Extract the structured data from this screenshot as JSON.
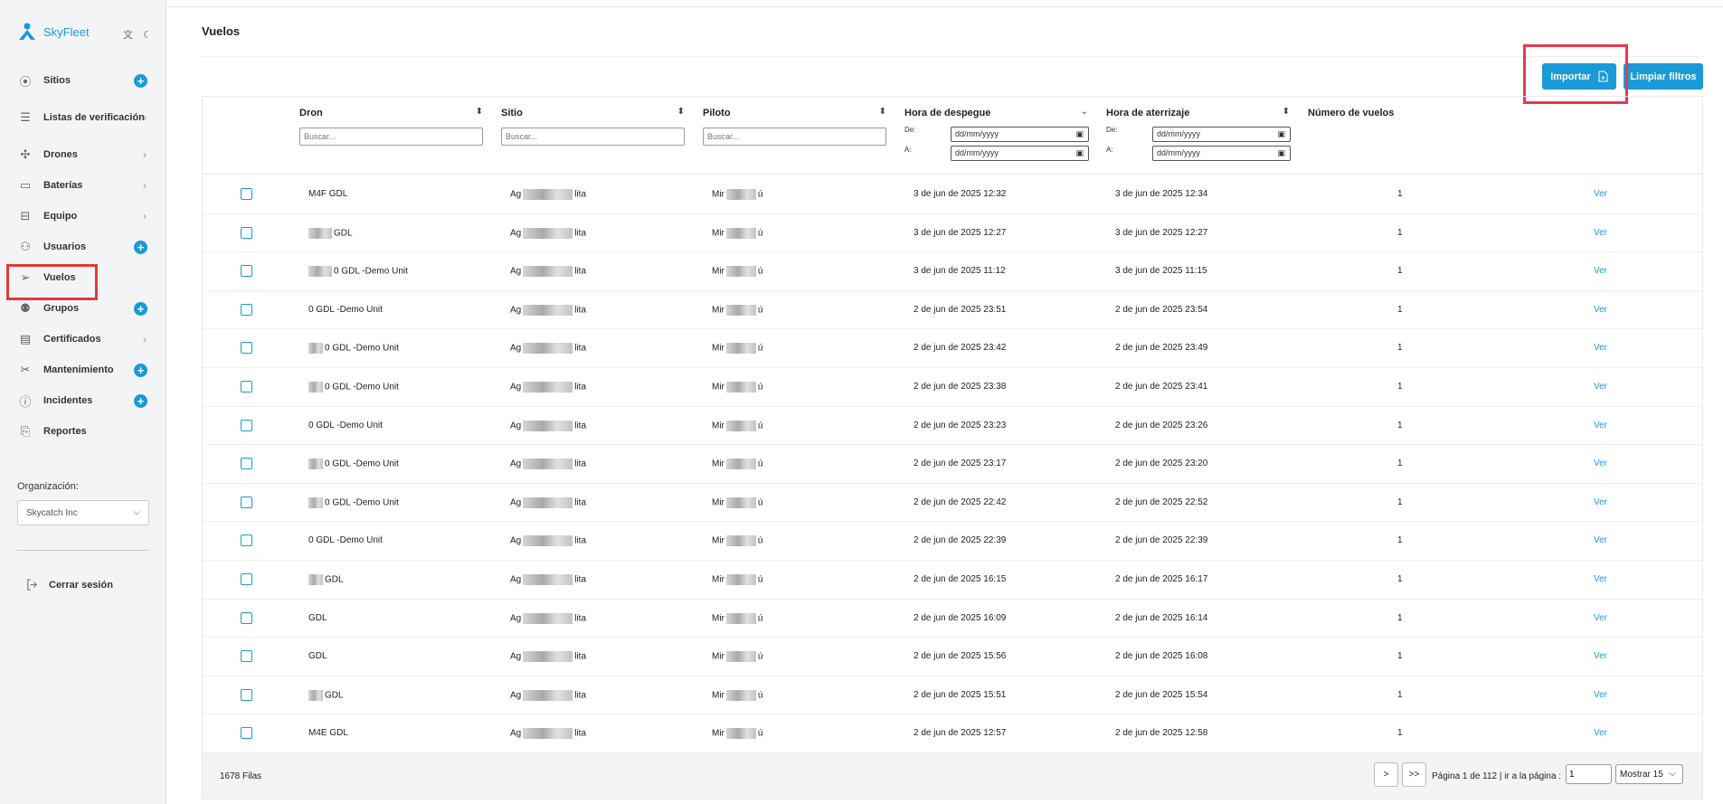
{
  "app": {
    "name": "SkyFleet",
    "top_icons": "文 ☾"
  },
  "sidebar": {
    "items": [
      {
        "label": "Sitios",
        "icon": "location-pin-icon",
        "action": "plus"
      },
      {
        "label": "Listas de verificación",
        "icon": "checklist-icon",
        "action": "chevron"
      },
      {
        "label": "Drones",
        "icon": "drone-icon",
        "action": "chevron"
      },
      {
        "label": "Baterías",
        "icon": "battery-icon",
        "action": "chevron"
      },
      {
        "label": "Equipo",
        "icon": "archive-box-icon",
        "action": "chevron"
      },
      {
        "label": "Usuarios",
        "icon": "users-icon",
        "action": "plus"
      },
      {
        "label": "Vuelos",
        "icon": "paper-plane-icon",
        "action": "none"
      },
      {
        "label": "Grupos",
        "icon": "group-icon",
        "action": "plus"
      },
      {
        "label": "Certificados",
        "icon": "document-icon",
        "action": "chevron"
      },
      {
        "label": "Mantenimiento",
        "icon": "tools-icon",
        "action": "plus"
      },
      {
        "label": "Incidentes",
        "icon": "alert-circle-icon",
        "action": "plus"
      },
      {
        "label": "Reportes",
        "icon": "reports-icon",
        "action": "none"
      }
    ],
    "org_label": "Organización:",
    "org_value": "Skycatch Inc",
    "logout_label": "Cerrar sesión"
  },
  "page": {
    "title": "Vuelos",
    "import_label": "Importar",
    "clear_filters_label": "Limpiar filtros"
  },
  "table": {
    "columns": {
      "dron": "Dron",
      "sitio": "Sitio",
      "piloto": "Piloto",
      "despegue": "Hora de despegue",
      "aterrizaje": "Hora de aterrizaje",
      "num_vuelos": "Número de vuelos"
    },
    "search_placeholder": "Buscar...",
    "date_from_label": "De:",
    "date_to_label": "A:",
    "date_placeholder": "dd/mm/yyyy",
    "view_label": "Ver",
    "rows": [
      {
        "dron": "M4F GDL",
        "sitio_a": "Ag",
        "sitio_b": "lita",
        "piloto_a": "Mir",
        "piloto_b": "ú",
        "despegue": "3 de jun de 2025 12:32",
        "aterrizaje": "3 de jun de 2025 12:34",
        "num": "1"
      },
      {
        "dron": "GDL",
        "sitio_a": "Ag",
        "sitio_b": "lita",
        "piloto_a": "Mir",
        "piloto_b": "ú",
        "despegue": "3 de jun de 2025 12:27",
        "aterrizaje": "3 de jun de 2025 12:27",
        "num": "1"
      },
      {
        "dron": "0 GDL -Demo Unit",
        "sitio_a": "Ag",
        "sitio_b": "lita",
        "piloto_a": "Mir",
        "piloto_b": "ú",
        "despegue": "3 de jun de 2025 11:12",
        "aterrizaje": "3 de jun de 2025 11:15",
        "num": "1"
      },
      {
        "dron": "0 GDL -Demo Unit",
        "sitio_a": "Ag",
        "sitio_b": "lita",
        "piloto_a": "Mir",
        "piloto_b": "ú",
        "despegue": "2 de jun de 2025 23:51",
        "aterrizaje": "2 de jun de 2025 23:54",
        "num": "1"
      },
      {
        "dron": "0 GDL -Demo Unit",
        "sitio_a": "Ag",
        "sitio_b": "lita",
        "piloto_a": "Mir",
        "piloto_b": "ú",
        "despegue": "2 de jun de 2025 23:42",
        "aterrizaje": "2 de jun de 2025 23:49",
        "num": "1"
      },
      {
        "dron": "0 GDL -Demo Unit",
        "sitio_a": "Ag",
        "sitio_b": "lita",
        "piloto_a": "Mir",
        "piloto_b": "ú",
        "despegue": "2 de jun de 2025 23:38",
        "aterrizaje": "2 de jun de 2025 23:41",
        "num": "1"
      },
      {
        "dron": "0 GDL -Demo Unit",
        "sitio_a": "Ag",
        "sitio_b": "lita",
        "piloto_a": "Mir",
        "piloto_b": "ú",
        "despegue": "2 de jun de 2025 23:23",
        "aterrizaje": "2 de jun de 2025 23:26",
        "num": "1"
      },
      {
        "dron": "0 GDL -Demo Unit",
        "sitio_a": "Ag",
        "sitio_b": "lita",
        "piloto_a": "Mir",
        "piloto_b": "ú",
        "despegue": "2 de jun de 2025 23:17",
        "aterrizaje": "2 de jun de 2025 23:20",
        "num": "1"
      },
      {
        "dron": "0 GDL -Demo Unit",
        "sitio_a": "Ag",
        "sitio_b": "lita",
        "piloto_a": "Mir",
        "piloto_b": "ú",
        "despegue": "2 de jun de 2025 22:42",
        "aterrizaje": "2 de jun de 2025 22:52",
        "num": "1"
      },
      {
        "dron": "0 GDL -Demo Unit",
        "sitio_a": "Ag",
        "sitio_b": "lita",
        "piloto_a": "Mir",
        "piloto_b": "ú",
        "despegue": "2 de jun de 2025 22:39",
        "aterrizaje": "2 de jun de 2025 22:39",
        "num": "1"
      },
      {
        "dron": "GDL",
        "sitio_a": "Ag",
        "sitio_b": "lita",
        "piloto_a": "Mir",
        "piloto_b": "ú",
        "despegue": "2 de jun de 2025 16:15",
        "aterrizaje": "2 de jun de 2025 16:17",
        "num": "1"
      },
      {
        "dron": "GDL",
        "sitio_a": "Ag",
        "sitio_b": "lita",
        "piloto_a": "Mir",
        "piloto_b": "ú",
        "despegue": "2 de jun de 2025 16:09",
        "aterrizaje": "2 de jun de 2025 16:14",
        "num": "1"
      },
      {
        "dron": "GDL",
        "sitio_a": "Ag",
        "sitio_b": "lita",
        "piloto_a": "Mir",
        "piloto_b": "ú",
        "despegue": "2 de jun de 2025 15:56",
        "aterrizaje": "2 de jun de 2025 16:08",
        "num": "1"
      },
      {
        "dron": "GDL",
        "sitio_a": "Ag",
        "sitio_b": "lita",
        "piloto_a": "Mir",
        "piloto_b": "ú",
        "despegue": "2 de jun de 2025 15:51",
        "aterrizaje": "2 de jun de 2025 15:54",
        "num": "1"
      },
      {
        "dron": "M4E GDL",
        "sitio_a": "Ag",
        "sitio_b": "lita",
        "piloto_a": "Mir",
        "piloto_b": "ú",
        "despegue": "2 de jun de 2025 12:57",
        "aterrizaje": "2 de jun de 2025 12:58",
        "num": "1"
      }
    ]
  },
  "footer": {
    "rows_count": "1678 Filas",
    "next_label": ">",
    "last_label": ">>",
    "page_info": "Página 1 de 112 | ir a la página :",
    "page_input": "1",
    "show_label": "Mostrar 15"
  }
}
